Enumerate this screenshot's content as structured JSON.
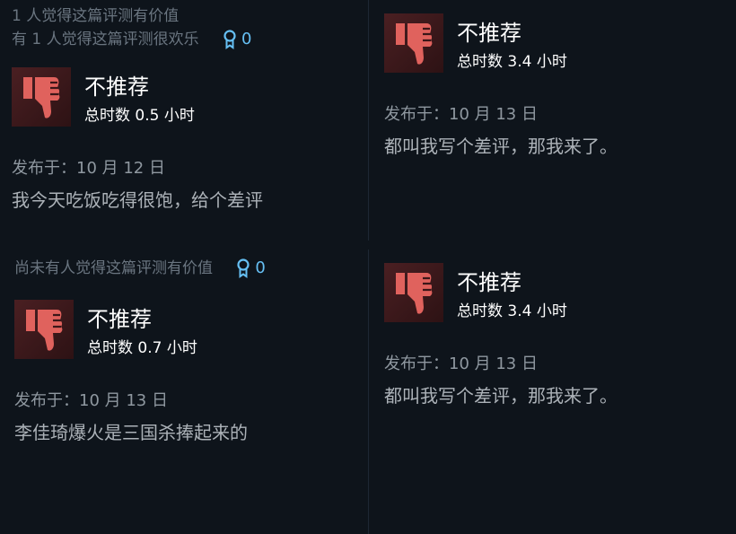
{
  "colors": {
    "background": "#0e141b",
    "thumb_down": "#e0625d",
    "award_blue": "#66c0f4"
  },
  "reviews": [
    {
      "helpful": "1 人觉得这篇评测有价值",
      "funny": "有 1 人觉得这篇评测很欢乐",
      "award_icon": "award-ribbon-icon",
      "award_count": "0",
      "verdict_icon": "thumbs-down-icon",
      "verdict": "不推荐",
      "hours": "总时数 0.5 小时",
      "posted": "发布于：10 月 12 日",
      "text": "我今天吃饭吃得很饱，给个差评"
    },
    {
      "verdict_icon": "thumbs-down-icon",
      "verdict": "不推荐",
      "hours": "总时数 3.4 小时",
      "posted": "发布于：10 月 13 日",
      "text": "都叫我写个差评，那我来了。"
    },
    {
      "helpful": "尚未有人觉得这篇评测有价值",
      "award_icon": "award-ribbon-icon",
      "award_count": "0",
      "verdict_icon": "thumbs-down-icon",
      "verdict": "不推荐",
      "hours": "总时数 0.7 小时",
      "posted": "发布于：10 月 13 日",
      "text": "李佳琦爆火是三国杀捧起来的"
    },
    {
      "verdict_icon": "thumbs-down-icon",
      "verdict": "不推荐",
      "hours": "总时数 3.4 小时",
      "posted": "发布于：10 月 13 日",
      "text": "都叫我写个差评，那我来了。"
    }
  ]
}
